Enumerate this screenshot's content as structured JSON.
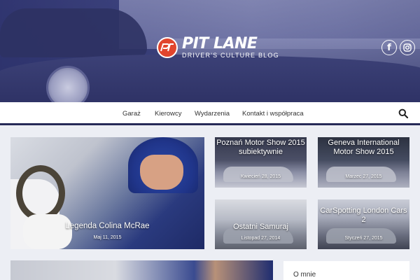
{
  "header": {
    "logo_title": "PIT LANE",
    "logo_subtitle": "DRIVER'S CULTURE BLOG",
    "social": [
      {
        "name": "facebook",
        "glyph": "f"
      },
      {
        "name": "instagram",
        "glyph": "◎"
      }
    ]
  },
  "nav": {
    "items": [
      "Garaż",
      "Kierowcy",
      "Wydarzenia",
      "Kontakt i współpraca"
    ],
    "search_icon": "search-icon"
  },
  "posts": {
    "featured": {
      "title": "Legenda Colina McRae",
      "date": "Maj 11, 2015"
    },
    "poznan": {
      "title": "Poznań Motor Show 2015 subiektywnie",
      "date": "Kwiecień 28, 2015"
    },
    "geneva": {
      "title": "Geneva International Motor Show 2015",
      "date": "Marzec 27, 2015"
    },
    "samurai": {
      "title": "Ostatni Samuraj",
      "date": "Listopad 27, 2014"
    },
    "london": {
      "title": "CarSpotting London Cars 2",
      "date": "Styczeń 27, 2015"
    }
  },
  "sidebar": {
    "widget_title": "O mnie"
  },
  "colors": {
    "accent": "#e1452d",
    "nav_border": "#262a58",
    "banner_overlay": "#2f3468"
  }
}
